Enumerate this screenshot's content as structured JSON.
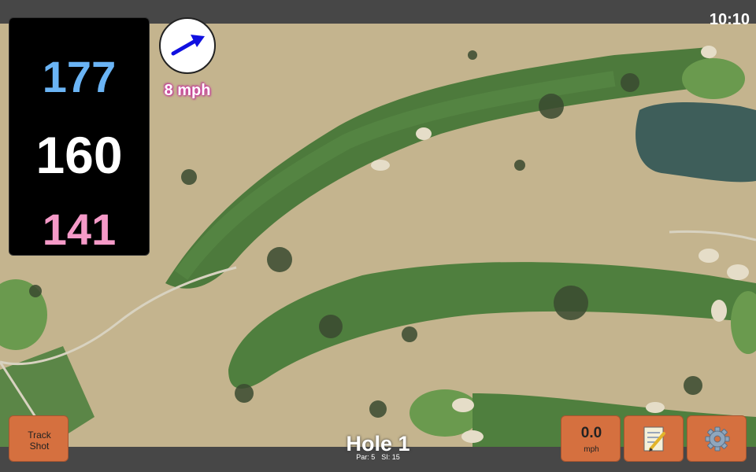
{
  "status_bar": {
    "time": "10:10"
  },
  "yardages": {
    "back": "177",
    "middle": "160",
    "front": "141"
  },
  "wind": {
    "speed_label": "8 mph",
    "icon": "wind-direction-arrow-icon"
  },
  "track_shot": {
    "label_line1": "Track",
    "label_line2": "Shot"
  },
  "hole": {
    "title": "Hole 1",
    "par_label": "Par: 5",
    "si_label": "SI: 15"
  },
  "speed_button": {
    "value": "0.0",
    "unit": "mph"
  },
  "notes_button": {
    "icon": "notepad-icon"
  },
  "settings_button": {
    "icon": "gear-icon"
  },
  "colors": {
    "back_yardage": "#6ab4f5",
    "middle_yardage": "#ffffff",
    "front_yardage": "#f59ac8",
    "button": "#d5703f",
    "wind_arrow": "#1010e0",
    "wind_text_glow": "#d94ba8"
  }
}
